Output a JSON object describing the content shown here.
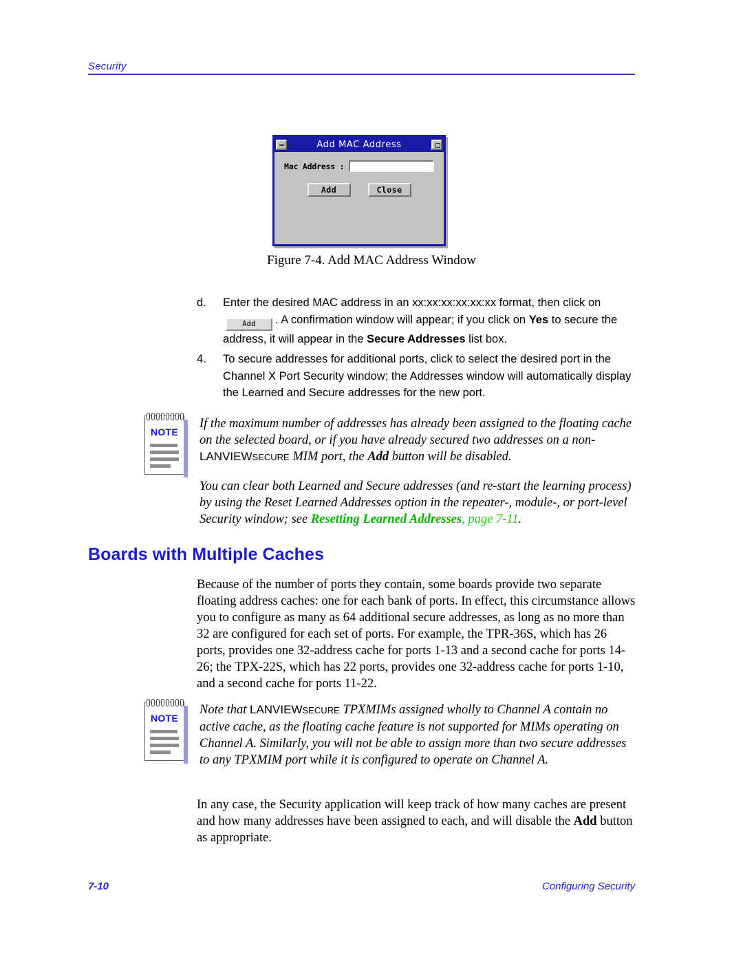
{
  "header": {
    "title": "Security"
  },
  "figure": {
    "window": {
      "title": "Add MAC Address",
      "field_label": "Mac Address  :",
      "field_value": "",
      "field_placeholder": "",
      "add_label": "Add",
      "close_label": "Close",
      "minimize_icon": "minimize-icon",
      "maximize_icon": "maximize-icon"
    },
    "caption": "Figure 7-4.  Add MAC Address Window"
  },
  "steps": {
    "step_d": {
      "marker": "d.",
      "text_1": "Enter the desired MAC address in an xx:xx:xx:xx:xx:xx format, then click on",
      "inline_button": "Add",
      "text_2": ". A confirmation window will appear; if you click on",
      "bold_1": "Yes",
      "text_3": "to secure the address, it will appear in the",
      "bold_2": "Secure Addresses",
      "text_4": "list box."
    },
    "step_4": {
      "marker": "4.",
      "text": "To secure addresses for additional ports, click to select the desired port in the Channel X Port Security window; the Addresses window will automatically display the Learned and Secure addresses for the new port."
    }
  },
  "note_1": {
    "badge": "NOTE",
    "paragraph_1_part_1": "If the maximum number of addresses has already been assigned to the floating cache on the selected board, or if you have already secured two addresses on a non-",
    "brand_main": "LANVIEW",
    "brand_sub": "SECURE",
    "paragraph_1_part_2": "MIM port, the",
    "paragraph_1_bold": "Add",
    "paragraph_1_part_3": "button will be disabled.",
    "paragraph_2_part_1": "You can clear both Learned and Secure addresses (and re-start the learning process) by using the Reset Learned Addresses option in the repeater-, module-, or port-level Security window; see",
    "paragraph_2_link": "Resetting Learned Addresses",
    "paragraph_2_link_page": ", page 7-11",
    "paragraph_2_part_2": "."
  },
  "section": {
    "heading": "Boards with Multiple Caches",
    "paragraph": "Because of the number of ports they contain, some boards provide two separate floating address caches: one for each bank of ports. In effect, this circumstance allows you to configure as many as 64 additional secure addresses, as long as no more than 32 are configured for each set of ports. For example, the TPR-36S, which has 26 ports, provides one 32-address cache for ports 1-13 and a second cache for ports 14-26; the TPX-22S, which has 22 ports, provides one 32-address cache for ports 1-10, and a second cache for ports 11-22."
  },
  "note_2": {
    "badge": "NOTE",
    "text_part_1": "Note that",
    "brand_main": "LANVIEW",
    "brand_sub": "SECURE",
    "text_part_2": "TPXMIMs assigned wholly to Channel A contain no active cache, as the floating cache feature is not supported for MIMs operating on Channel A. Similarly, you will not be able to assign more than two secure addresses to any TPXMIM port while it is configured to operate on Channel A."
  },
  "closing": {
    "text_part_1": "In any case, the Security application will keep track of how many caches are present and how many addresses have been assigned to each, and will disable the",
    "bold": "Add",
    "text_part_2": "button as appropriate."
  },
  "footer": {
    "page_number": "7-10",
    "doc_title": "Configuring Security"
  },
  "colors": {
    "accent_blue": "#1a1ad2",
    "header_blue": "#2222cc",
    "link_green": "#00b300",
    "titlebar_blue": "#1a1aa8",
    "dialog_gray": "#c3c3c3"
  }
}
